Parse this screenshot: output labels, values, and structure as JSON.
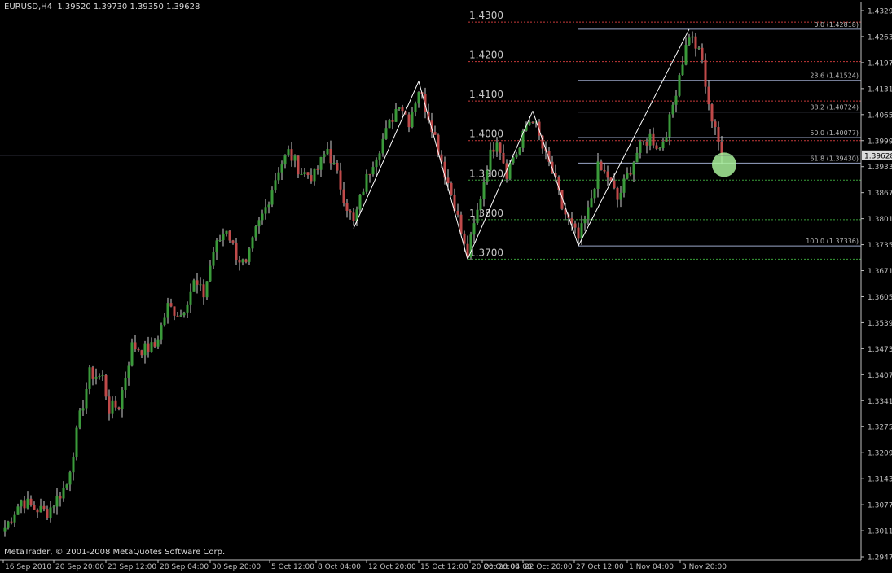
{
  "header": {
    "symbol": "EURUSD,H4",
    "open": "1.39520",
    "high": "1.39730",
    "low": "1.39350",
    "close": "1.39628"
  },
  "copyright": "MetaTrader, © 2001-2008 MetaQuotes Software Corp.",
  "chart_data": {
    "type": "candlestick",
    "symbol": "EURUSD",
    "timeframe": "H4",
    "ylim": [
      1.2932,
      1.4337
    ],
    "y_ticks": [
      "1.43290",
      "1.42630",
      "1.41970",
      "1.41310",
      "1.40650",
      "1.39990",
      "1.39330",
      "1.38670",
      "1.38010",
      "1.37350",
      "1.36710",
      "1.36050",
      "1.35390",
      "1.34730",
      "1.34070",
      "1.33410",
      "1.32750",
      "1.32090",
      "1.31430",
      "1.30770",
      "1.30110",
      "1.29470"
    ],
    "x_ticks": [
      "16 Sep 2010",
      "20 Sep 20:00",
      "23 Sep 12:00",
      "28 Sep 04:00",
      "30 Sep 20:00",
      "5 Oct 12:00",
      "8 Oct 04:00",
      "12 Oct 20:00",
      "15 Oct 12:00",
      "20 Oct 20:00",
      "20 Oct 04:00",
      "22 Oct 20:00",
      "27 Oct 12:00",
      "1 Nov 04:00",
      "3 Nov 20:00"
    ],
    "current_price": "1.39628",
    "colors": {
      "bull": "#3a9a3a",
      "bear": "#c04a4a",
      "grid": "#3a3a3a",
      "axis": "#c0c0c0",
      "fib": "#9aa6c8",
      "circle": "#a8f09a"
    },
    "price_levels": [
      {
        "label": "1.4300",
        "value": 1.43,
        "color": "#c83a3a"
      },
      {
        "label": "1.4200",
        "value": 1.42,
        "color": "#c83a3a"
      },
      {
        "label": "1.4100",
        "value": 1.41,
        "color": "#c83a3a"
      },
      {
        "label": "1.4000",
        "value": 1.4,
        "color": "#c83a3a"
      },
      {
        "label": "1.3900",
        "value": 1.39,
        "color": "#3aa03a"
      },
      {
        "label": "1.3800",
        "value": 1.38,
        "color": "#3aa03a"
      },
      {
        "label": "1.3700",
        "value": 1.37,
        "color": "#3aa03a"
      }
    ],
    "fibonacci": [
      {
        "label": "0.0 (1.42818)",
        "value": 1.42818
      },
      {
        "label": "23.6 (1.41524)",
        "value": 1.41524
      },
      {
        "label": "38.2 (1.40724)",
        "value": 1.40724
      },
      {
        "label": "50.0 (1.40077)",
        "value": 1.40077
      },
      {
        "label": "61.8 (1.39430)",
        "value": 1.3943
      },
      {
        "label": "100.0 (1.37336)",
        "value": 1.37336
      }
    ],
    "zigzag": [
      {
        "bar": 107,
        "price": 1.3778
      },
      {
        "bar": 127,
        "price": 1.415
      },
      {
        "bar": 142,
        "price": 1.37
      },
      {
        "bar": 162,
        "price": 1.4075
      },
      {
        "bar": 176,
        "price": 1.3734
      },
      {
        "bar": 210,
        "price": 1.4282
      }
    ],
    "highlight": {
      "bar": 219,
      "price": 1.3943
    },
    "waypoints": [
      [
        0,
        1.302
      ],
      [
        5,
        1.309
      ],
      [
        9,
        1.307
      ],
      [
        13,
        1.306
      ],
      [
        19,
        1.313
      ],
      [
        23,
        1.33
      ],
      [
        26,
        1.341
      ],
      [
        30,
        1.34
      ],
      [
        32,
        1.332
      ],
      [
        35,
        1.333
      ],
      [
        39,
        1.348
      ],
      [
        43,
        1.347
      ],
      [
        46,
        1.348
      ],
      [
        50,
        1.358
      ],
      [
        54,
        1.356
      ],
      [
        58,
        1.364
      ],
      [
        61,
        1.361
      ],
      [
        64,
        1.372
      ],
      [
        68,
        1.378
      ],
      [
        71,
        1.371
      ],
      [
        74,
        1.368
      ],
      [
        77,
        1.377
      ],
      [
        80,
        1.383
      ],
      [
        84,
        1.393
      ],
      [
        87,
        1.397
      ],
      [
        91,
        1.392
      ],
      [
        95,
        1.391
      ],
      [
        99,
        1.398
      ],
      [
        102,
        1.391
      ],
      [
        106,
        1.381
      ],
      [
        107,
        1.379
      ],
      [
        110,
        1.388
      ],
      [
        113,
        1.395
      ],
      [
        117,
        1.402
      ],
      [
        121,
        1.41
      ],
      [
        124,
        1.405
      ],
      [
        127,
        1.413
      ],
      [
        131,
        1.404
      ],
      [
        135,
        1.392
      ],
      [
        138,
        1.384
      ],
      [
        141,
        1.373
      ],
      [
        142,
        1.371
      ],
      [
        145,
        1.382
      ],
      [
        148,
        1.394
      ],
      [
        151,
        1.401
      ],
      [
        154,
        1.392
      ],
      [
        156,
        1.396
      ],
      [
        158,
        1.398
      ],
      [
        160,
        1.404
      ],
      [
        162,
        1.406
      ],
      [
        165,
        1.398
      ],
      [
        168,
        1.392
      ],
      [
        171,
        1.383
      ],
      [
        174,
        1.378
      ],
      [
        176,
        1.375
      ],
      [
        179,
        1.382
      ],
      [
        182,
        1.393
      ],
      [
        185,
        1.391
      ],
      [
        188,
        1.385
      ],
      [
        190,
        1.389
      ],
      [
        194,
        1.397
      ],
      [
        198,
        1.401
      ],
      [
        201,
        1.398
      ],
      [
        204,
        1.405
      ],
      [
        207,
        1.417
      ],
      [
        210,
        1.427
      ],
      [
        212,
        1.424
      ],
      [
        214,
        1.42
      ],
      [
        216,
        1.408
      ],
      [
        218,
        1.404
      ],
      [
        220,
        1.396
      ]
    ]
  }
}
